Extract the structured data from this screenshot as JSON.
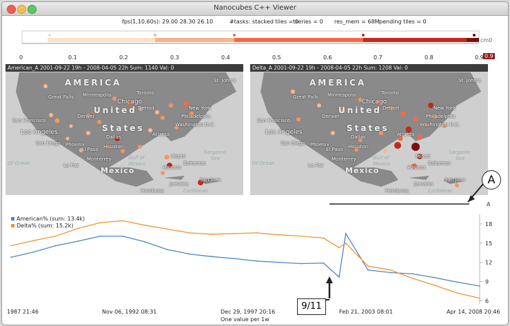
{
  "window": {
    "title": "Nanocubes C++ Viewer"
  },
  "stats": {
    "fps": "fps(1,10,60s): 29.00 28.30 26.10",
    "tasks": "#tasks:  stacked tiles = 0",
    "tseries": "tseries = 0",
    "res_mem": "res_mem = 68M",
    "pending": "pending tiles = 0"
  },
  "colorscale": {
    "ticks": [
      "0",
      "0.1",
      "0.2",
      "0.3",
      "0.4",
      "0.5",
      "0.6",
      "0.7",
      "0.8",
      "0.9"
    ],
    "end_label": "cm0",
    "value_badge": "0.9",
    "colors": [
      "#fde1c6",
      "#f7b289",
      "#ef6b48",
      "#c3291d",
      "#7c0f0e"
    ]
  },
  "maps": [
    {
      "header": "American_A    2001-09-22 19h - 2008-04-05 22h Sum: 1140 Val: 0"
    },
    {
      "header": "Delta_A    2001-09-22 19h - 2008-04-05 22h Sum: 1208 Val: 0"
    }
  ],
  "map_labels": {
    "america": "AMERICA",
    "united": "United",
    "states": "States",
    "mexico_big": "Mexico",
    "gulf": "Gulf of",
    "gulf2": "Mexico",
    "sargasso": "Sargasso",
    "sea": "Sea",
    "caribbean": "Caribbean",
    "ocean": "Of Ocean",
    "cities": [
      "Minneapolis",
      "Chicago",
      "New York",
      "Philadelphia",
      "Washington D.C.",
      "San Francisco",
      "Los Angeles",
      "San Diego",
      "Denver",
      "Phoenix",
      "El Paso",
      "Dallas",
      "Houston",
      "Monterrey",
      "Mexico",
      "Miami",
      "Havana",
      "Bahamas",
      "Jamaica",
      "San Juan",
      "Honduras",
      "La Paz",
      "Great Falls",
      "St. John's",
      "Toronto",
      "Detroit",
      "Atlanta"
    ]
  },
  "annotation_A": {
    "circle": "A",
    "small": "A"
  },
  "annotation_911": "9/11",
  "chart_data": {
    "type": "line",
    "x": [
      "1987",
      "1988",
      "1989",
      "1990",
      "1991",
      "1992",
      "1993",
      "1994",
      "1995",
      "1996",
      "1997",
      "1998",
      "1999",
      "2000",
      "2001",
      "2001.7",
      "2002",
      "2003",
      "2004",
      "2005",
      "2006",
      "2007",
      "2008"
    ],
    "series": [
      {
        "name": "American%",
        "sum_label": "American%   (sum: 13.4k)",
        "color": "#4a86c5",
        "values": [
          12.8,
          13.6,
          14.6,
          15.3,
          16.1,
          16.1,
          15.2,
          14.0,
          13.3,
          12.9,
          12.6,
          12.2,
          12.0,
          11.8,
          11.9,
          9.7,
          16.5,
          10.8,
          10.4,
          10.2,
          9.6,
          8.9,
          8.3
        ]
      },
      {
        "name": "Delta%",
        "sum_label": "Delta%   (sum: 15.2k)",
        "color": "#f0942a",
        "values": [
          14.6,
          15.4,
          16.1,
          17.3,
          18.2,
          18.5,
          17.8,
          17.2,
          16.6,
          16.4,
          16.5,
          16.6,
          16.3,
          16.1,
          15.8,
          14.3,
          15.0,
          11.4,
          10.8,
          9.5,
          8.4,
          7.2,
          6.4
        ]
      }
    ],
    "yticks": [
      "18",
      "15",
      "12",
      "9",
      "6"
    ],
    "ylim": [
      5.5,
      19.5
    ],
    "xlabels": [
      "1987 21:46",
      "Nov 06, 1992 08:31",
      "Dec 29, 1997 20:16",
      "Feb 21, 2003 08:01",
      "Apr 14, 2008 20:46"
    ],
    "xcaption": "One value per 1w",
    "grid": false,
    "legend": "top-left"
  }
}
